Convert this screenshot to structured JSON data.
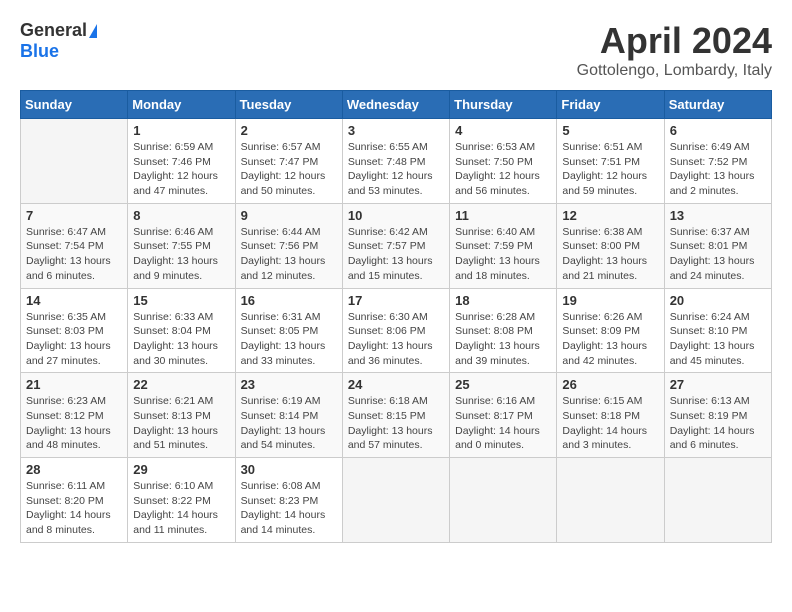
{
  "header": {
    "logo_general": "General",
    "logo_blue": "Blue",
    "title": "April 2024",
    "subtitle": "Gottolengo, Lombardy, Italy"
  },
  "calendar": {
    "days_of_week": [
      "Sunday",
      "Monday",
      "Tuesday",
      "Wednesday",
      "Thursday",
      "Friday",
      "Saturday"
    ],
    "weeks": [
      [
        {
          "day": "",
          "detail": ""
        },
        {
          "day": "1",
          "detail": "Sunrise: 6:59 AM\nSunset: 7:46 PM\nDaylight: 12 hours\nand 47 minutes."
        },
        {
          "day": "2",
          "detail": "Sunrise: 6:57 AM\nSunset: 7:47 PM\nDaylight: 12 hours\nand 50 minutes."
        },
        {
          "day": "3",
          "detail": "Sunrise: 6:55 AM\nSunset: 7:48 PM\nDaylight: 12 hours\nand 53 minutes."
        },
        {
          "day": "4",
          "detail": "Sunrise: 6:53 AM\nSunset: 7:50 PM\nDaylight: 12 hours\nand 56 minutes."
        },
        {
          "day": "5",
          "detail": "Sunrise: 6:51 AM\nSunset: 7:51 PM\nDaylight: 12 hours\nand 59 minutes."
        },
        {
          "day": "6",
          "detail": "Sunrise: 6:49 AM\nSunset: 7:52 PM\nDaylight: 13 hours\nand 2 minutes."
        }
      ],
      [
        {
          "day": "7",
          "detail": "Sunrise: 6:47 AM\nSunset: 7:54 PM\nDaylight: 13 hours\nand 6 minutes."
        },
        {
          "day": "8",
          "detail": "Sunrise: 6:46 AM\nSunset: 7:55 PM\nDaylight: 13 hours\nand 9 minutes."
        },
        {
          "day": "9",
          "detail": "Sunrise: 6:44 AM\nSunset: 7:56 PM\nDaylight: 13 hours\nand 12 minutes."
        },
        {
          "day": "10",
          "detail": "Sunrise: 6:42 AM\nSunset: 7:57 PM\nDaylight: 13 hours\nand 15 minutes."
        },
        {
          "day": "11",
          "detail": "Sunrise: 6:40 AM\nSunset: 7:59 PM\nDaylight: 13 hours\nand 18 minutes."
        },
        {
          "day": "12",
          "detail": "Sunrise: 6:38 AM\nSunset: 8:00 PM\nDaylight: 13 hours\nand 21 minutes."
        },
        {
          "day": "13",
          "detail": "Sunrise: 6:37 AM\nSunset: 8:01 PM\nDaylight: 13 hours\nand 24 minutes."
        }
      ],
      [
        {
          "day": "14",
          "detail": "Sunrise: 6:35 AM\nSunset: 8:03 PM\nDaylight: 13 hours\nand 27 minutes."
        },
        {
          "day": "15",
          "detail": "Sunrise: 6:33 AM\nSunset: 8:04 PM\nDaylight: 13 hours\nand 30 minutes."
        },
        {
          "day": "16",
          "detail": "Sunrise: 6:31 AM\nSunset: 8:05 PM\nDaylight: 13 hours\nand 33 minutes."
        },
        {
          "day": "17",
          "detail": "Sunrise: 6:30 AM\nSunset: 8:06 PM\nDaylight: 13 hours\nand 36 minutes."
        },
        {
          "day": "18",
          "detail": "Sunrise: 6:28 AM\nSunset: 8:08 PM\nDaylight: 13 hours\nand 39 minutes."
        },
        {
          "day": "19",
          "detail": "Sunrise: 6:26 AM\nSunset: 8:09 PM\nDaylight: 13 hours\nand 42 minutes."
        },
        {
          "day": "20",
          "detail": "Sunrise: 6:24 AM\nSunset: 8:10 PM\nDaylight: 13 hours\nand 45 minutes."
        }
      ],
      [
        {
          "day": "21",
          "detail": "Sunrise: 6:23 AM\nSunset: 8:12 PM\nDaylight: 13 hours\nand 48 minutes."
        },
        {
          "day": "22",
          "detail": "Sunrise: 6:21 AM\nSunset: 8:13 PM\nDaylight: 13 hours\nand 51 minutes."
        },
        {
          "day": "23",
          "detail": "Sunrise: 6:19 AM\nSunset: 8:14 PM\nDaylight: 13 hours\nand 54 minutes."
        },
        {
          "day": "24",
          "detail": "Sunrise: 6:18 AM\nSunset: 8:15 PM\nDaylight: 13 hours\nand 57 minutes."
        },
        {
          "day": "25",
          "detail": "Sunrise: 6:16 AM\nSunset: 8:17 PM\nDaylight: 14 hours\nand 0 minutes."
        },
        {
          "day": "26",
          "detail": "Sunrise: 6:15 AM\nSunset: 8:18 PM\nDaylight: 14 hours\nand 3 minutes."
        },
        {
          "day": "27",
          "detail": "Sunrise: 6:13 AM\nSunset: 8:19 PM\nDaylight: 14 hours\nand 6 minutes."
        }
      ],
      [
        {
          "day": "28",
          "detail": "Sunrise: 6:11 AM\nSunset: 8:20 PM\nDaylight: 14 hours\nand 8 minutes."
        },
        {
          "day": "29",
          "detail": "Sunrise: 6:10 AM\nSunset: 8:22 PM\nDaylight: 14 hours\nand 11 minutes."
        },
        {
          "day": "30",
          "detail": "Sunrise: 6:08 AM\nSunset: 8:23 PM\nDaylight: 14 hours\nand 14 minutes."
        },
        {
          "day": "",
          "detail": ""
        },
        {
          "day": "",
          "detail": ""
        },
        {
          "day": "",
          "detail": ""
        },
        {
          "day": "",
          "detail": ""
        }
      ]
    ]
  }
}
